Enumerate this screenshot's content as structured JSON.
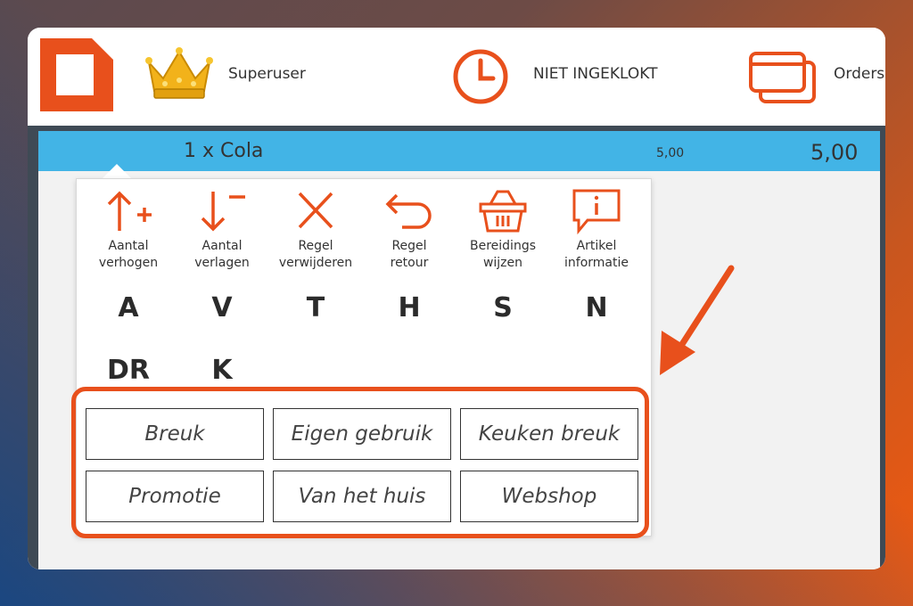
{
  "header": {
    "user_name": "Superuser",
    "clock_status": "NIET INGEKLOKT",
    "orders_label": "Orders"
  },
  "order_line": {
    "description": "1 x Cola",
    "unit_price": "5,00",
    "total_price": "5,00"
  },
  "actions": [
    {
      "label1": "Aantal",
      "label2": "verhogen",
      "letter": "A",
      "icon": "quantity-up-icon"
    },
    {
      "label1": "Aantal",
      "label2": "verlagen",
      "letter": "V",
      "icon": "quantity-down-icon"
    },
    {
      "label1": "Regel",
      "label2": "verwijderen",
      "letter": "T",
      "icon": "delete-x-icon"
    },
    {
      "label1": "Regel",
      "label2": "retour",
      "letter": "H",
      "icon": "return-arrow-icon"
    },
    {
      "label1": "Bereidings",
      "label2": "wijzen",
      "letter": "S",
      "icon": "basket-icon"
    },
    {
      "label1": "Artikel",
      "label2": "informatie",
      "letter": "N",
      "icon": "info-bubble-icon"
    }
  ],
  "extra_letters": [
    "DR",
    "K"
  ],
  "reasons": [
    "Breuk",
    "Eigen gebruik",
    "Keuken breuk",
    "Promotie",
    "Van het huis",
    "Webshop"
  ],
  "colors": {
    "accent": "#e8501c",
    "order_row": "#42b4e6",
    "crown": "#f2b21a"
  }
}
